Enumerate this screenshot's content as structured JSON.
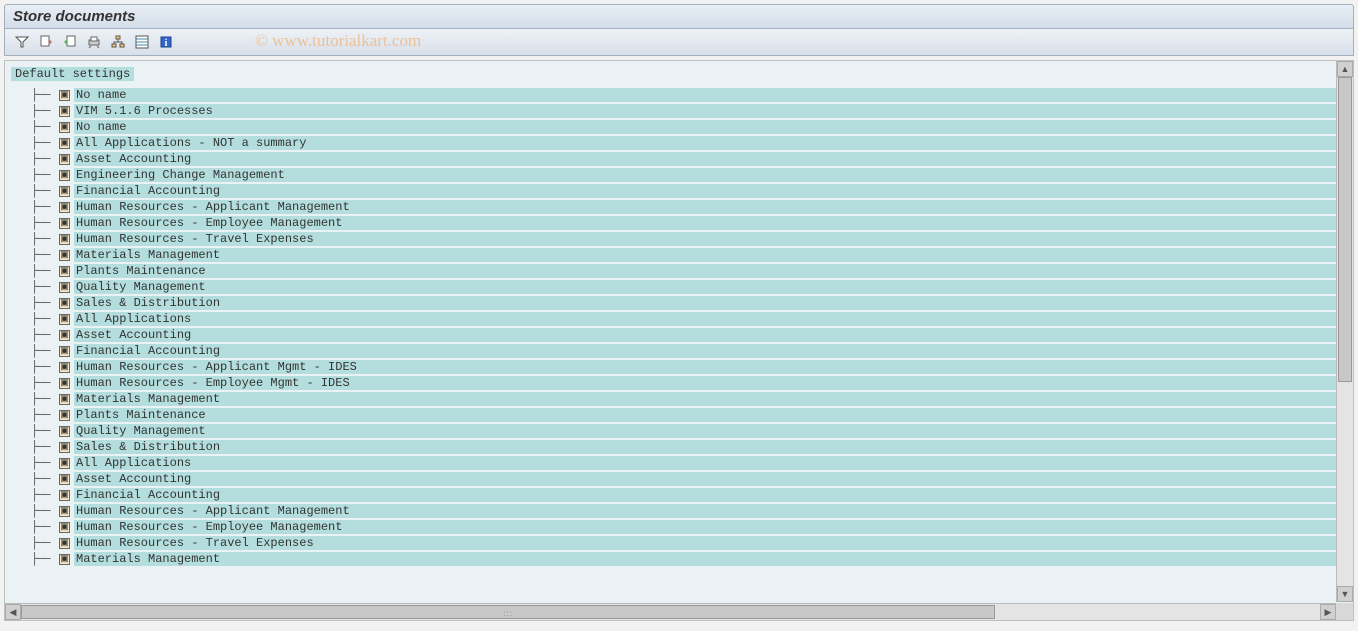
{
  "title": "Store documents",
  "watermark": "© www.tutorialkart.com",
  "toolbar": {
    "icons": [
      "funnel-icon",
      "doc-in-icon",
      "doc-out-icon",
      "print-icon",
      "hierarchy-icon",
      "list-icon",
      "info-icon"
    ]
  },
  "tree": {
    "root_label": "Default settings",
    "items": [
      {
        "label": "No name"
      },
      {
        "label": "VIM 5.1.6 Processes"
      },
      {
        "label": "No name"
      },
      {
        "label": "All Applications - NOT a summary"
      },
      {
        "label": "Asset Accounting"
      },
      {
        "label": "Engineering Change Management"
      },
      {
        "label": "Financial Accounting"
      },
      {
        "label": "Human Resources - Applicant Management"
      },
      {
        "label": "Human Resources - Employee Management"
      },
      {
        "label": "Human Resources - Travel Expenses"
      },
      {
        "label": "Materials Management"
      },
      {
        "label": "Plants Maintenance"
      },
      {
        "label": "Quality Management"
      },
      {
        "label": "Sales & Distribution"
      },
      {
        "label": "All Applications"
      },
      {
        "label": "Asset Accounting"
      },
      {
        "label": "Financial Accounting"
      },
      {
        "label": "Human Resources - Applicant Mgmt - IDES"
      },
      {
        "label": "Human Resources - Employee Mgmt - IDES"
      },
      {
        "label": "Materials Management"
      },
      {
        "label": "Plants Maintenance"
      },
      {
        "label": "Quality Management"
      },
      {
        "label": "Sales & Distribution"
      },
      {
        "label": "All Applications"
      },
      {
        "label": "Asset Accounting"
      },
      {
        "label": "Financial Accounting"
      },
      {
        "label": "Human Resources - Applicant Management"
      },
      {
        "label": "Human Resources - Employee Management"
      },
      {
        "label": "Human Resources - Travel Expenses"
      },
      {
        "label": "Materials Management"
      }
    ]
  }
}
